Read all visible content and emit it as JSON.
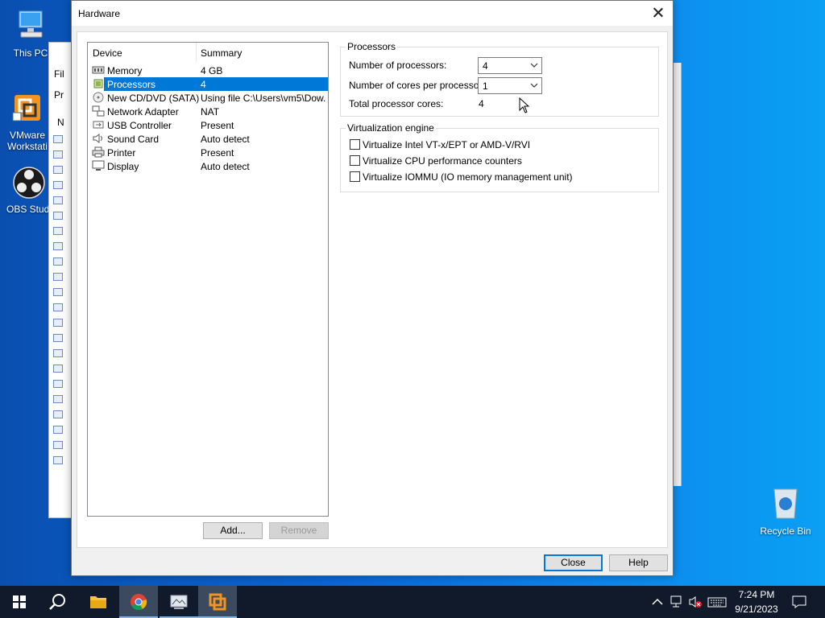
{
  "desktop": {
    "icons": [
      {
        "label": "This PC"
      },
      {
        "label": "VMware Workstati"
      },
      {
        "label": "OBS Studi"
      },
      {
        "label": "Recycle Bin"
      }
    ],
    "bg_window_fragments": [
      "Fil",
      "Pr",
      "N"
    ]
  },
  "dialog": {
    "title": "Hardware",
    "device_list": {
      "headers": {
        "device": "Device",
        "summary": "Summary"
      },
      "rows": [
        {
          "icon": "memory-icon",
          "name": "Memory",
          "summary": "4 GB"
        },
        {
          "icon": "processor-icon",
          "name": "Processors",
          "summary": "4",
          "selected": true
        },
        {
          "icon": "cd-dvd-icon",
          "name": "New CD/DVD (SATA)",
          "summary": "Using file C:\\Users\\vm5\\Dow..."
        },
        {
          "icon": "network-adapter-icon",
          "name": "Network Adapter",
          "summary": "NAT"
        },
        {
          "icon": "usb-icon",
          "name": "USB Controller",
          "summary": "Present"
        },
        {
          "icon": "sound-icon",
          "name": "Sound Card",
          "summary": "Auto detect"
        },
        {
          "icon": "printer-icon",
          "name": "Printer",
          "summary": "Present"
        },
        {
          "icon": "display-icon",
          "name": "Display",
          "summary": "Auto detect"
        }
      ]
    },
    "buttons": {
      "add": "Add...",
      "remove": "Remove",
      "close": "Close",
      "help": "Help"
    },
    "processors": {
      "group_label": "Processors",
      "num_processors_label": "Number of processors:",
      "num_processors_value": "4",
      "cores_label": "Number of cores per processor:",
      "cores_value": "1",
      "total_label": "Total processor cores:",
      "total_value": "4"
    },
    "virtualization": {
      "group_label": "Virtualization engine",
      "options": [
        {
          "label": "Virtualize Intel VT-x/EPT or AMD-V/RVI",
          "checked": false
        },
        {
          "label": "Virtualize CPU performance counters",
          "checked": false
        },
        {
          "label": "Virtualize IOMMU (IO memory management unit)",
          "checked": false
        }
      ]
    }
  },
  "taskbar": {
    "apps": [
      {
        "icon": "windows-start-icon"
      },
      {
        "icon": "search-icon"
      },
      {
        "icon": "file-explorer-icon"
      },
      {
        "icon": "chrome-icon"
      },
      {
        "icon": "network-window-icon"
      },
      {
        "icon": "vmware-icon"
      }
    ],
    "time": "7:24 PM",
    "date": "9/21/2023"
  }
}
